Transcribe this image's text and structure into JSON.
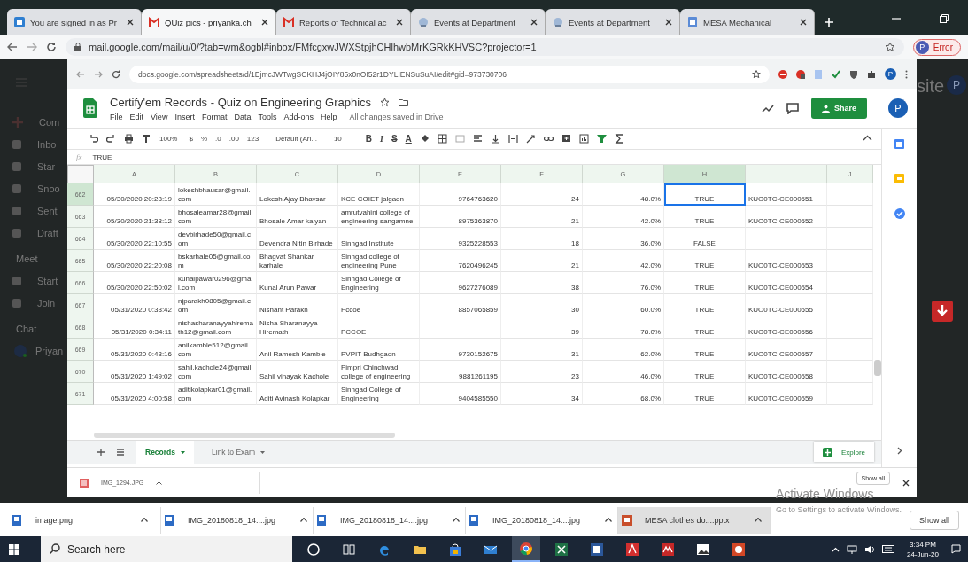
{
  "browser": {
    "tabs": [
      {
        "title": "You are signed in as Pr",
        "kind": "site",
        "selected": false
      },
      {
        "title": "QUiz pics - priyanka.ch",
        "kind": "mail",
        "selected": true
      },
      {
        "title": "Reports of Technical ac",
        "kind": "mail",
        "selected": false
      },
      {
        "title": "Events at Department",
        "kind": "globe",
        "selected": false
      },
      {
        "title": "Events at Department",
        "kind": "globe",
        "selected": false
      },
      {
        "title": "MESA Mechanical",
        "kind": "page",
        "selected": false
      }
    ],
    "address": "mail.google.com/mail/u/0/?tab=wm&ogbl#inbox/FMfcgxwJWXStpjhCHlhwbMrKGRkKHVSC?projector=1",
    "profile": "P",
    "profile_status": "Error"
  },
  "gmail_background": {
    "items": [
      {
        "label": "Com",
        "kind": "compose"
      },
      {
        "label": "Inbo",
        "kind": "item"
      },
      {
        "label": "Star",
        "kind": "item"
      },
      {
        "label": "Snoo",
        "kind": "item"
      },
      {
        "label": "Sent",
        "kind": "item"
      },
      {
        "label": "Draft",
        "kind": "item"
      },
      {
        "label": "Meet",
        "kind": "heading"
      },
      {
        "label": "Start",
        "kind": "item"
      },
      {
        "label": "Join",
        "kind": "item"
      },
      {
        "label": "Chat",
        "kind": "heading"
      },
      {
        "label": "Priyan",
        "kind": "person"
      }
    ],
    "header_fragment": "site",
    "profile": "P"
  },
  "sheet": {
    "address": "docs.google.com/spreadsheets/d/1EjmcJWTwgSCKHJ4jOIY85x0nOI52r1DYLIENSuSuAI/edit#gid=973730706",
    "address_profile": "P",
    "profile": "P",
    "title": "Certify'em Records - Quiz on Engineering Graphics",
    "menu": [
      "File",
      "Edit",
      "View",
      "Insert",
      "Format",
      "Data",
      "Tools",
      "Add-ons",
      "Help"
    ],
    "save_status": "All changes saved in Drive",
    "share": "Share",
    "toolbar": {
      "zoom": "100%",
      "currency": "$",
      "percent": "%",
      "decimal_less": ".0",
      "decimal_more": ".00",
      "number_format": "123",
      "font": "Default (Ari...",
      "size": "10",
      "text_styles": [
        "B",
        "I",
        "S",
        "A"
      ]
    },
    "formula": {
      "label": "fx",
      "value": "TRUE"
    },
    "columns": [
      {
        "label": "A",
        "selected": false
      },
      {
        "label": "B",
        "selected": false
      },
      {
        "label": "C",
        "selected": false
      },
      {
        "label": "D",
        "selected": false
      },
      {
        "label": "E",
        "selected": false
      },
      {
        "label": "F",
        "selected": false
      },
      {
        "label": "G",
        "selected": false
      },
      {
        "label": "H",
        "selected": true
      },
      {
        "label": "I",
        "selected": false
      },
      {
        "label": "J",
        "selected": false
      }
    ],
    "rows": [
      {
        "number": "662",
        "selected": true,
        "cells": [
          "05/30/2020 20:28:19",
          "lokeshbhausar@gmail.com",
          "Lokesh Ajay Bhavsar",
          "KCE COIET jalgaon",
          "9764763620",
          "24",
          "48.0%",
          "TRUE",
          "KUO0TC-CE000551"
        ]
      },
      {
        "number": "663",
        "selected": false,
        "cells": [
          "05/30/2020 21:38:12",
          "bhosaleamar28@gmail.com",
          "Bhosale Amar kalyan",
          "amrutvahini college of engineering sangamne",
          "8975363870",
          "21",
          "42.0%",
          "TRUE",
          "KUO0TC-CE000552"
        ]
      },
      {
        "number": "664",
        "selected": false,
        "cells": [
          "05/30/2020 22:10:55",
          "devbirhade50@gmail.com",
          "Devendra Nitin Birhade",
          "Sinhgad Institute",
          "9325228553",
          "18",
          "36.0%",
          "FALSE",
          null
        ]
      },
      {
        "number": "665",
        "selected": false,
        "cells": [
          "05/30/2020 22:20:08",
          "bskarhale05@gmail.com",
          "Bhagvat Shankar karhale",
          "Sinhgad college of engineering Pune",
          "7620496245",
          "21",
          "42.0%",
          "TRUE",
          "KUO0TC-CE000553"
        ]
      },
      {
        "number": "666",
        "selected": false,
        "cells": [
          "05/30/2020 22:50:02",
          "kunalpawar0296@gmail.com",
          "Kunal Arun Pawar",
          "Sinhgad College of Engineering",
          "9627276089",
          "38",
          "76.0%",
          "TRUE",
          "KUO0TC-CE000554"
        ]
      },
      {
        "number": "667",
        "selected": false,
        "cells": [
          "05/31/2020 0:33:42",
          "njparakh0805@gmail.com",
          "Nishant Parakh",
          "Pccoe",
          "8857065859",
          "30",
          "60.0%",
          "TRUE",
          "KUO0TC-CE000555"
        ]
      },
      {
        "number": "668",
        "selected": false,
        "cells": [
          "05/31/2020 0:34:11",
          "nishasharanayyahiremath12@gmail.com",
          "Nisha Sharanayya Hiremath",
          "PCCOE",
          null,
          "39",
          "78.0%",
          "TRUE",
          "KUO0TC-CE000556"
        ]
      },
      {
        "number": "669",
        "selected": false,
        "cells": [
          "05/31/2020 0:43:16",
          "anilkamble512@gmail.com",
          "Anil Ramesh Kamble",
          "PVPIT Budhgaon",
          "9730152675",
          "31",
          "62.0%",
          "TRUE",
          "KUO0TC-CE000557"
        ]
      },
      {
        "number": "670",
        "selected": false,
        "cells": [
          "05/31/2020 1:49:02",
          "sahil.kachole24@gmail.com",
          "Sahil vinayak Kachole",
          "Pimpri Chinchwad college of engineering",
          "9881261195",
          "23",
          "46.0%",
          "TRUE",
          "KUO0TC-CE000558"
        ]
      },
      {
        "number": "671",
        "selected": false,
        "cells": [
          "05/31/2020 4:00:58",
          "aditikolapkar01@gmail.com",
          "Aditi Avinash Kolapkar",
          "Sinhgad College of Engineering",
          "9404585550",
          "34",
          "68.0%",
          "TRUE",
          "KUO0TC-CE000559"
        ]
      }
    ],
    "sheet_tabs": [
      {
        "label": "Records",
        "selected": true
      },
      {
        "label": "Link to Exam",
        "selected": false
      }
    ],
    "explore": "Explore",
    "downloads": [
      {
        "name": "IMG_1294.JPG"
      }
    ],
    "show_all": "Show all"
  },
  "downloads": {
    "items": [
      {
        "name": "image.png",
        "kind": "image",
        "highlighted": false
      },
      {
        "name": "IMG_20180818_14....jpg",
        "kind": "image",
        "highlighted": false
      },
      {
        "name": "IMG_20180818_14....jpg",
        "kind": "image",
        "highlighted": false
      },
      {
        "name": "IMG_20180818_14....jpg",
        "kind": "image",
        "highlighted": false
      },
      {
        "name": "MESA clothes do....pptx",
        "kind": "slides",
        "highlighted": true
      }
    ],
    "show_all": "Show all"
  },
  "activation_notice": {
    "title": "Activate Windows",
    "hint": "Go to Settings to activate Windows."
  },
  "taskbar": {
    "search": {
      "placeholder": "Search here"
    },
    "apps": [
      {
        "kind": "cortana",
        "selected": false
      },
      {
        "kind": "taskview",
        "selected": false
      },
      {
        "kind": "edge",
        "selected": false
      },
      {
        "kind": "folder",
        "selected": false
      },
      {
        "kind": "store",
        "selected": false
      },
      {
        "kind": "mail",
        "selected": false
      },
      {
        "kind": "chrome",
        "selected": true
      },
      {
        "kind": "excel",
        "selected": false
      },
      {
        "kind": "word",
        "selected": false
      },
      {
        "kind": "acrobat",
        "selected": false
      },
      {
        "kind": "redapp",
        "selected": false
      },
      {
        "kind": "photos",
        "selected": false
      },
      {
        "kind": "powerpoint",
        "selected": false
      }
    ],
    "time": "3:34 PM",
    "date": "24-Jun-20"
  }
}
